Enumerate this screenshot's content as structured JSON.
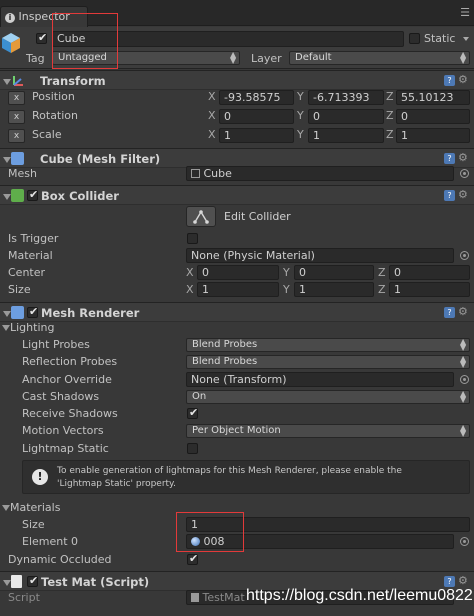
{
  "tab": {
    "icon": "info-icon",
    "title": "Inspector"
  },
  "object": {
    "active": true,
    "name": "Cube",
    "static_label": "Static",
    "tag_label": "Tag",
    "tag_value": "Untagged",
    "layer_label": "Layer",
    "layer_value": "Default"
  },
  "transform": {
    "title": "Transform",
    "rows": [
      {
        "label": "Position",
        "x": "-93.58575",
        "y": "-6.713393",
        "z": "55.10123"
      },
      {
        "label": "Rotation",
        "x": "0",
        "y": "0",
        "z": "0"
      },
      {
        "label": "Scale",
        "x": "1",
        "y": "1",
        "z": "1"
      }
    ],
    "reset_glyph": "x"
  },
  "axes": {
    "x": "X",
    "y": "Y",
    "z": "Z"
  },
  "mesh_filter": {
    "title": "Cube (Mesh Filter)",
    "mesh_label": "Mesh",
    "mesh_value": "Cube"
  },
  "box_collider": {
    "title": "Box Collider",
    "edit_label": "Edit Collider",
    "is_trigger_label": "Is Trigger",
    "material_label": "Material",
    "material_value": "None (Physic Material)",
    "center_label": "Center",
    "center": {
      "x": "0",
      "y": "0",
      "z": "0"
    },
    "size_label": "Size",
    "size": {
      "x": "1",
      "y": "1",
      "z": "1"
    }
  },
  "mesh_renderer": {
    "title": "Mesh Renderer",
    "lighting_label": "Lighting",
    "light_probes_label": "Light Probes",
    "light_probes_value": "Blend Probes",
    "reflection_probes_label": "Reflection Probes",
    "reflection_probes_value": "Blend Probes",
    "anchor_override_label": "Anchor Override",
    "anchor_override_value": "None (Transform)",
    "cast_shadows_label": "Cast Shadows",
    "cast_shadows_value": "On",
    "receive_shadows_label": "Receive Shadows",
    "motion_vectors_label": "Motion Vectors",
    "motion_vectors_value": "Per Object Motion",
    "lightmap_static_label": "Lightmap Static",
    "info_text_1": "To enable generation of lightmaps for this Mesh Renderer, please enable the",
    "info_text_2": "'Lightmap Static' property.",
    "materials_label": "Materials",
    "size_label": "Size",
    "size_value": "1",
    "element0_label": "Element 0",
    "element0_value": "008",
    "dynamic_occluded_label": "Dynamic Occluded"
  },
  "test_mat": {
    "title": "Test Mat (Script)",
    "script_label": "Script",
    "script_value": "TestMat"
  },
  "watermark": "https://blog.csdn.net/leemu0822"
}
